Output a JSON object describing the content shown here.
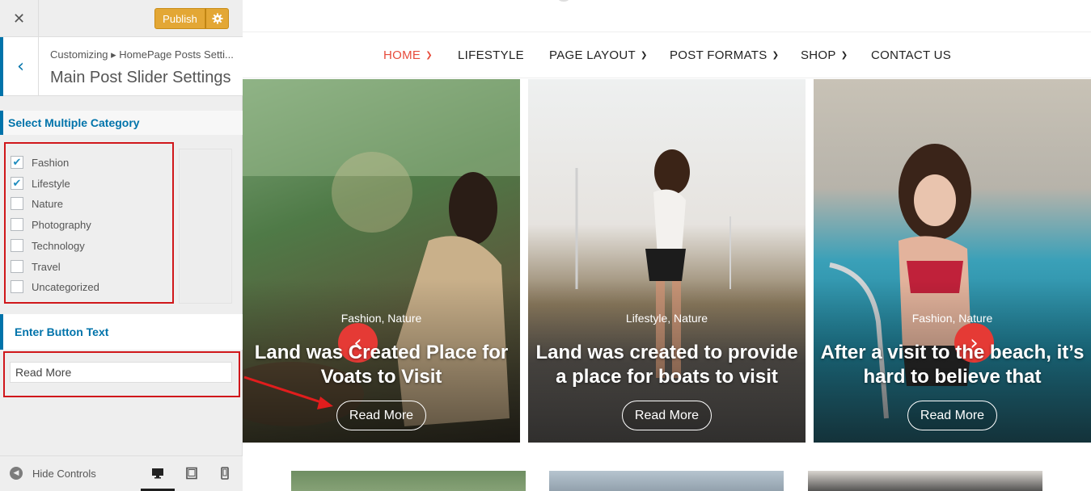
{
  "customizer": {
    "close_glyph": "✕",
    "publish_label": "Publish",
    "breadcrumb": "Customizing ▸ HomePage Posts Setti...",
    "section_title": "Main Post Slider Settings",
    "category_label": "Select Multiple Category",
    "categories": [
      {
        "label": "Fashion",
        "checked": true
      },
      {
        "label": "Lifestyle",
        "checked": true
      },
      {
        "label": "Nature",
        "checked": false
      },
      {
        "label": "Photography",
        "checked": false
      },
      {
        "label": "Technology",
        "checked": false
      },
      {
        "label": "Travel",
        "checked": false
      },
      {
        "label": "Uncategorized",
        "checked": false
      }
    ],
    "button_text_label": "Enter Button Text",
    "button_text_value": "Read More",
    "hide_controls": "Hide Controls",
    "active_device": "desktop",
    "accent_color": "#0073aa",
    "highlight_color": "#d0171b"
  },
  "preview": {
    "nav": [
      {
        "label": "HOME",
        "dropdown": true,
        "active": true
      },
      {
        "label": "LIFESTYLE",
        "dropdown": false,
        "active": false
      },
      {
        "label": "PAGE LAYOUT",
        "dropdown": true,
        "active": false
      },
      {
        "label": "POST FORMATS",
        "dropdown": true,
        "active": false
      },
      {
        "label": "SHOP",
        "dropdown": true,
        "active": false
      },
      {
        "label": "CONTACT US",
        "dropdown": false,
        "active": false
      }
    ],
    "slides": [
      {
        "categories": "Fashion, Nature",
        "title": "Land was Created Place for Voats to Visit",
        "button": "Read More"
      },
      {
        "categories": "Lifestyle, Nature",
        "title": "Land was created to provide a place for boats to visit",
        "button": "Read More"
      },
      {
        "categories": "Fashion, Nature",
        "title": "After a visit to the beach, it’s hard to believe that",
        "button": "Read More"
      }
    ],
    "prev_glyph": "‹",
    "next_glyph": "›",
    "nav_active_color": "#e74c3c",
    "arrow_color": "#e53a35"
  }
}
